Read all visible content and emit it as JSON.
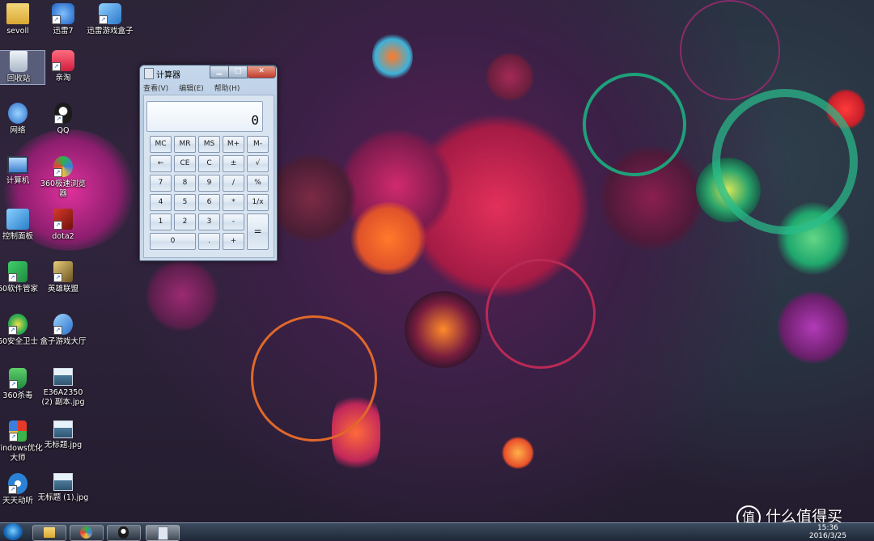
{
  "desktop": {
    "icons": [
      {
        "label": "sevoll",
        "icon": "folder-icon",
        "color": "#e8c35a"
      },
      {
        "label": "迅雷7",
        "icon": "xunlei-icon",
        "color": "#3a7bd5"
      },
      {
        "label": "迅雷游戏盒子",
        "icon": "game-box-icon",
        "color": "#4aa3e0"
      },
      {
        "label": "回收站",
        "icon": "recycle-bin-icon",
        "color": "#cfd8e3"
      },
      {
        "label": "亲淘",
        "icon": "qintao-icon",
        "color": "#e23a57"
      },
      {
        "label": "网络",
        "icon": "network-icon",
        "color": "#3d8be0"
      },
      {
        "label": "QQ",
        "icon": "qq-icon",
        "color": "#222222"
      },
      {
        "label": "计算机",
        "icon": "computer-icon",
        "color": "#5aa0e6"
      },
      {
        "label": "360极速浏览器",
        "icon": "360-browser-icon",
        "color": "#2bb34a"
      },
      {
        "label": "控制面板",
        "icon": "control-panel-icon",
        "color": "#3a9fd8"
      },
      {
        "label": "dota2",
        "icon": "dota2-icon",
        "color": "#b0261b"
      },
      {
        "label": "60软件管家",
        "icon": "360-software-icon",
        "color": "#2eab4f"
      },
      {
        "label": "英雄联盟",
        "icon": "lol-icon",
        "color": "#c9a74a"
      },
      {
        "label": "60安全卫士",
        "icon": "360-safe-icon",
        "color": "#2eab4f"
      },
      {
        "label": "盒子游戏大厅",
        "icon": "game-hall-icon",
        "color": "#3e86d6"
      },
      {
        "label": "360杀毒",
        "icon": "360-antivirus-icon",
        "color": "#3fb24f"
      },
      {
        "label": "E36A2350 (2) 副本.jpg",
        "icon": "image-file-icon",
        "color": "#6f8fa8"
      },
      {
        "label": "Windows优化大师",
        "icon": "windows-master-icon",
        "color": "#d83b2b"
      },
      {
        "label": "无标题.jpg",
        "icon": "image-file-icon",
        "color": "#6f8fa8"
      },
      {
        "label": "天天动听",
        "icon": "ttpod-icon",
        "color": "#3a8fd6"
      },
      {
        "label": "无标题 (1).jpg",
        "icon": "image-file-icon",
        "color": "#6f8fa8"
      }
    ]
  },
  "calculator": {
    "title": "计算器",
    "menus": [
      "查看(V)",
      "编辑(E)",
      "帮助(H)"
    ],
    "display": "0",
    "window_buttons": [
      "minimize",
      "maximize",
      "close"
    ],
    "keys": [
      [
        "MC",
        "MR",
        "MS",
        "M+",
        "M-"
      ],
      [
        "←",
        "CE",
        "C",
        "±",
        "√"
      ],
      [
        "7",
        "8",
        "9",
        "/",
        "%"
      ],
      [
        "4",
        "5",
        "6",
        "*",
        "1/x"
      ],
      [
        "1",
        "2",
        "3",
        "-",
        "="
      ],
      [
        "0",
        ".",
        "+"
      ]
    ]
  },
  "taskbar": {
    "start_icon": "windows-orb-icon",
    "pinned": [
      "file-explorer-icon",
      "360-browser-icon",
      "qq-icon",
      "calculator-icon"
    ],
    "clock_time": "15:36",
    "clock_date": "2016/3/25"
  },
  "watermark": {
    "text": "什么值得买",
    "logo": "值"
  }
}
